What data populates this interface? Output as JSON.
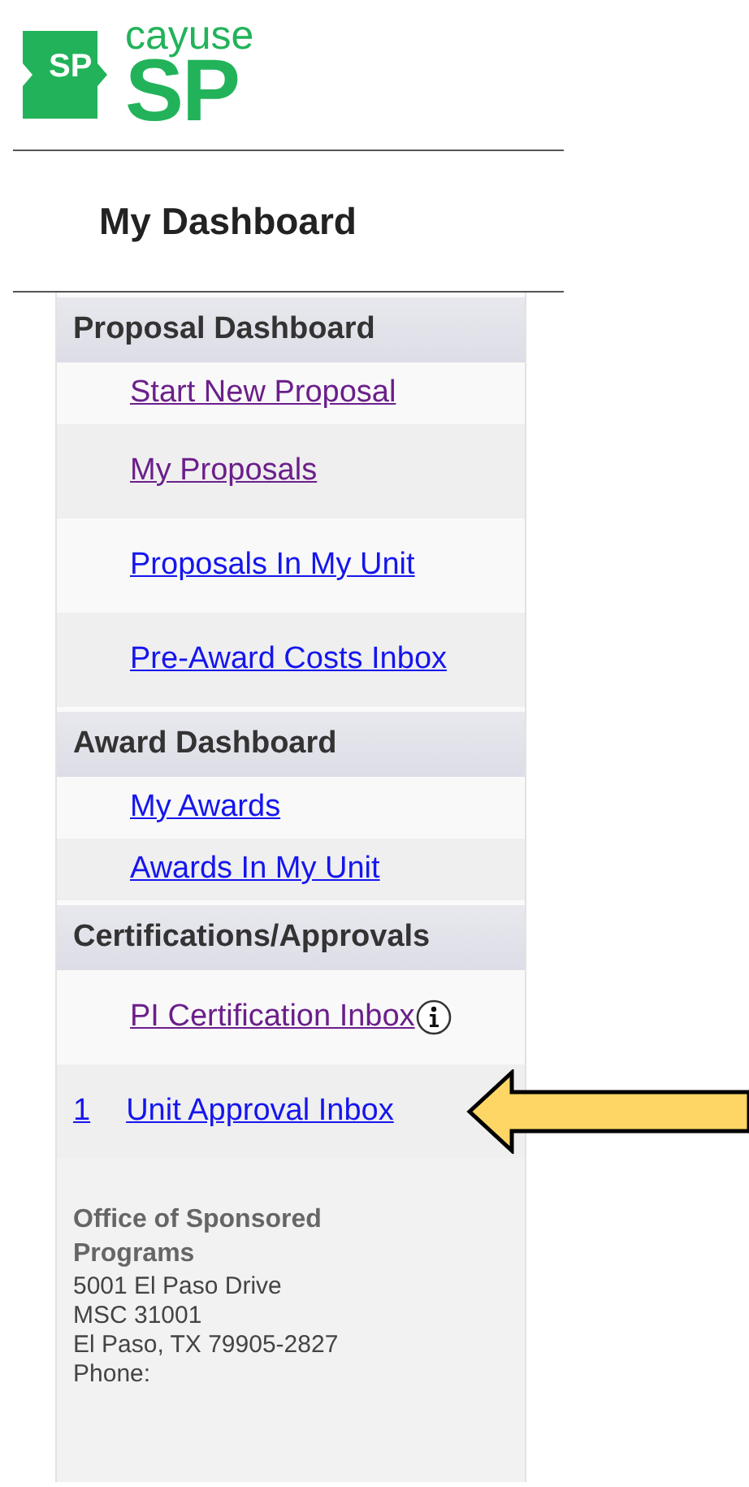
{
  "logo": {
    "badge": "SP",
    "wordmark": "cayuse",
    "product": "SP"
  },
  "page_title": "My Dashboard",
  "sections": [
    {
      "title": "Proposal Dashboard",
      "items": [
        {
          "label": "Start New Proposal",
          "visited": true
        },
        {
          "label": "My Proposals",
          "visited": true
        },
        {
          "label": "Proposals In My Unit",
          "visited": false
        },
        {
          "label": "Pre-Award Costs Inbox",
          "visited": false
        }
      ]
    },
    {
      "title": "Award Dashboard",
      "items": [
        {
          "label": "My Awards",
          "visited": false
        },
        {
          "label": "Awards In My Unit",
          "visited": false
        }
      ]
    },
    {
      "title": "Certifications/Approvals",
      "items": [
        {
          "label": "PI Certification Inbox",
          "visited": true,
          "info": true
        },
        {
          "label": "Unit Approval Inbox",
          "visited": false,
          "count": "1",
          "pointed": true
        }
      ]
    }
  ],
  "office": {
    "name": "Office of Sponsored Programs",
    "lines": [
      "5001 El Paso Drive",
      "MSC 31001",
      "El Paso, TX 79905-2827",
      "Phone:"
    ]
  }
}
